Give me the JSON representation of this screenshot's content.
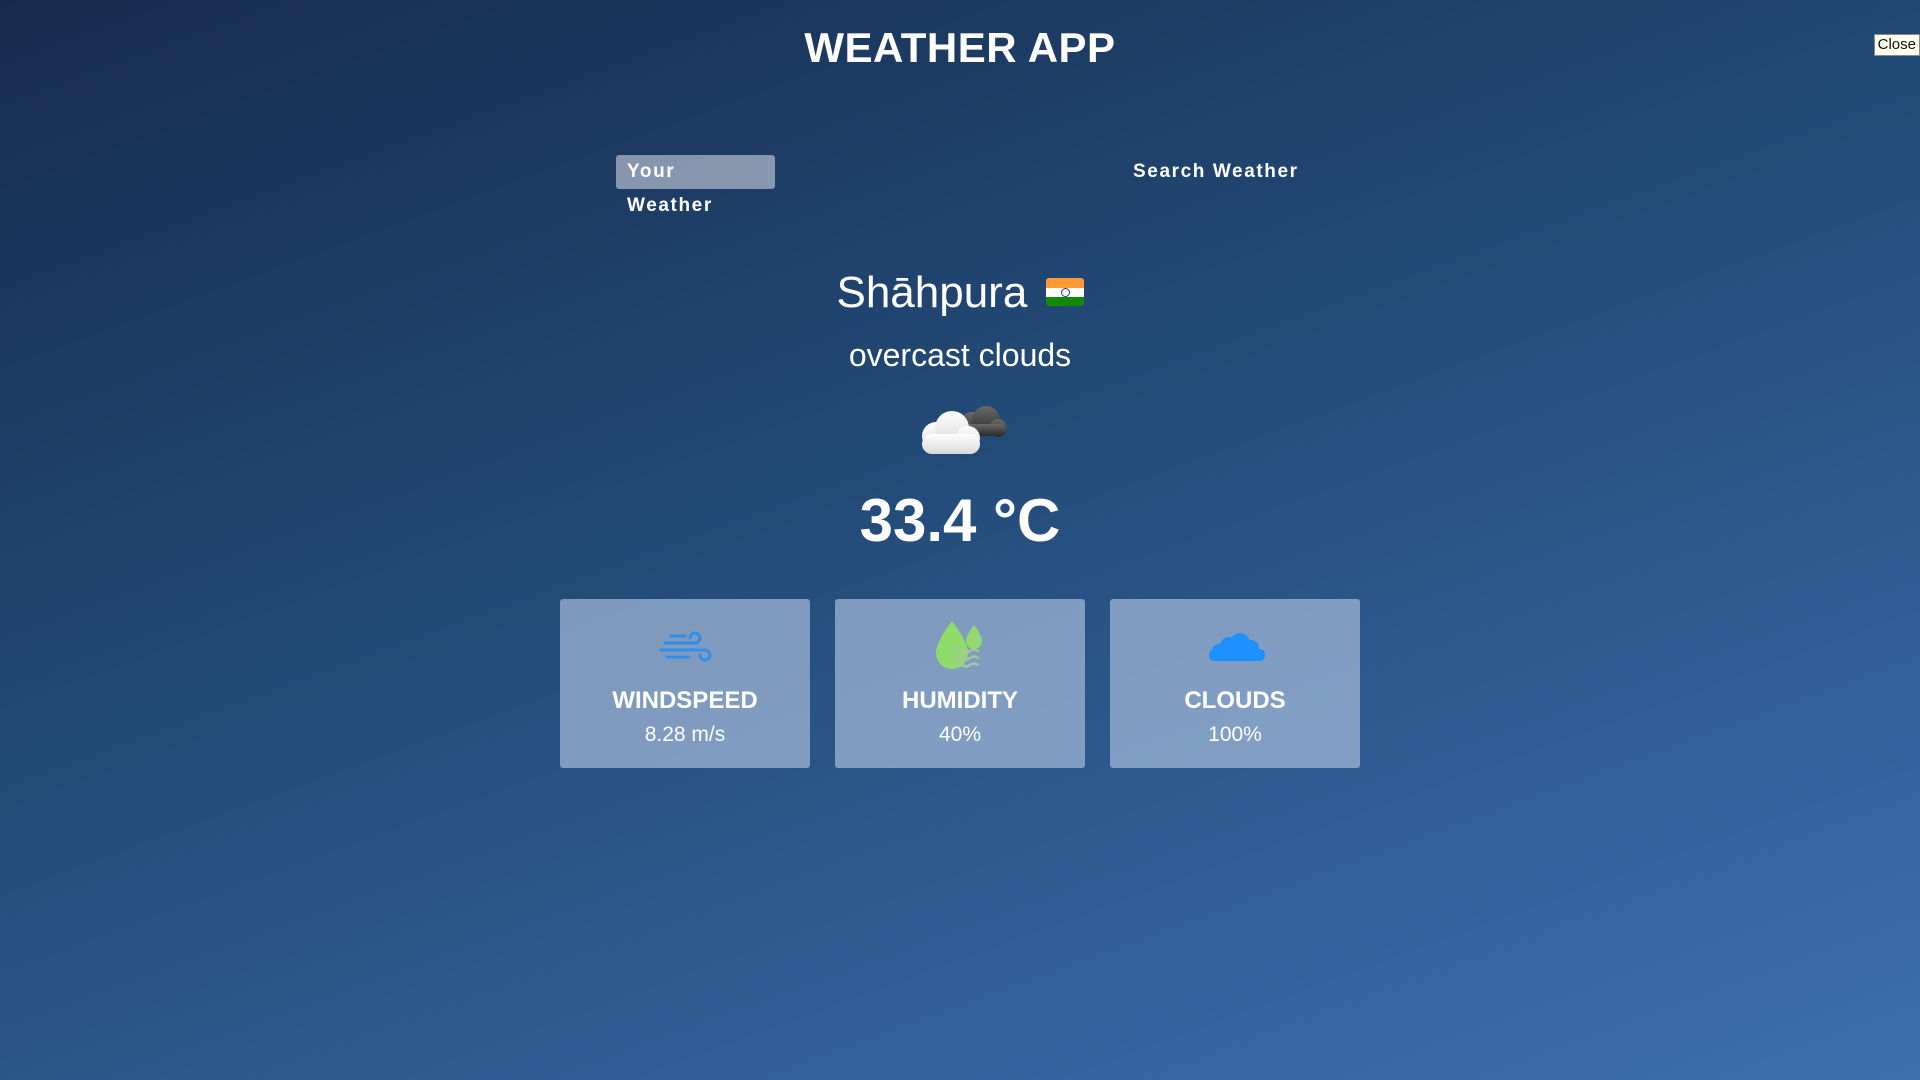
{
  "app": {
    "title": "WEATHER APP",
    "close_label": "Close"
  },
  "tabs": [
    {
      "label": "Your Weather",
      "active": true
    },
    {
      "label": "Search Weather",
      "active": false
    }
  ],
  "location": {
    "city": "Shāhpura",
    "flag_icon": "india-flag-icon",
    "flag_colors": [
      "#ff9933",
      "#ffffff",
      "#138808"
    ]
  },
  "weather": {
    "description": "overcast clouds",
    "icon": "overcast-clouds-icon",
    "temperature": "33.4 °C"
  },
  "stats": [
    {
      "title": "WINDSPEED",
      "value": "8.28 m/s",
      "icon": "wind-icon",
      "color": "#2f8fe8"
    },
    {
      "title": "HUMIDITY",
      "value": "40%",
      "icon": "humidity-drops-icon",
      "color": "#8fdc6a"
    },
    {
      "title": "CLOUDS",
      "value": "100%",
      "icon": "cloud-icon",
      "color": "#1e90ff"
    }
  ]
}
